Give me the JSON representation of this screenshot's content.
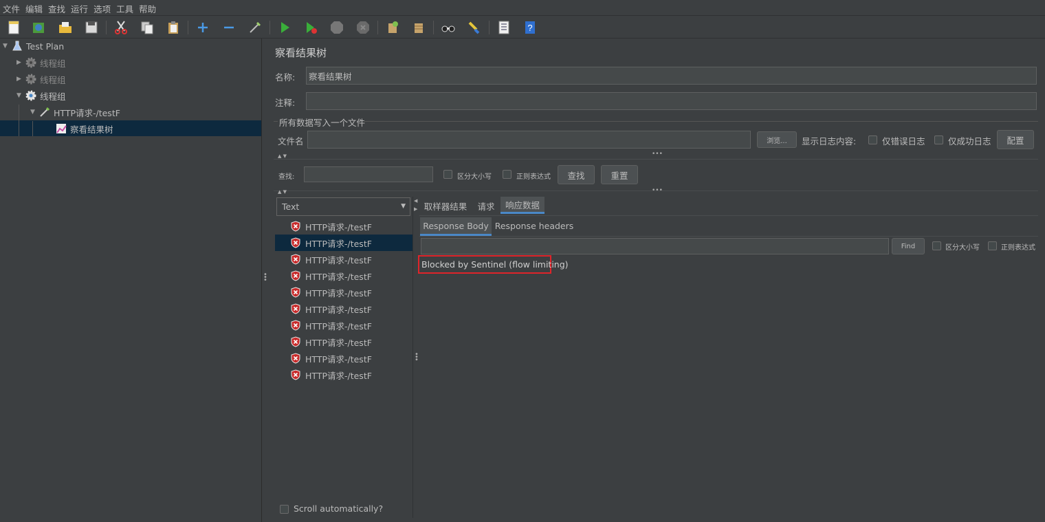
{
  "menu": [
    "文件",
    "编辑",
    "查找",
    "运行",
    "选项",
    "工具",
    "帮助"
  ],
  "toolbar_icons": [
    "new-icon",
    "templates-icon",
    "open-icon",
    "save-icon",
    "cut-icon",
    "copy-icon",
    "paste-icon",
    "expand-icon",
    "collapse-icon",
    "toggle-icon",
    "start-icon",
    "start-no-pause-icon",
    "stop-icon",
    "shutdown-icon",
    "clear-icon",
    "clear-all-icon",
    "search-icon",
    "reset-search-icon",
    "function-helper-icon",
    "help-icon"
  ],
  "tree": {
    "root": "Test Plan",
    "thread_group_1": "线程组",
    "thread_group_2": "线程组",
    "thread_group_3": "线程组",
    "http_sampler": "HTTP请求-/testF",
    "listener": "察看结果树"
  },
  "panel": {
    "title": "察看结果树",
    "name_label": "名称:",
    "name_value": "察看结果树",
    "comment_label": "注释:",
    "comment_value": "",
    "file_section": "所有数据写入一个文件",
    "filename_label": "文件名",
    "filename_value": "",
    "browse_button": "浏览...",
    "log_label": "显示日志内容:",
    "errors_only": "仅错误日志",
    "success_only": "仅成功日志",
    "configure_button": "配置"
  },
  "search": {
    "label": "查找:",
    "value": "",
    "case_sensitive": "区分大小写",
    "regex": "正则表达式",
    "find_button": "查找",
    "reset_button": "重置"
  },
  "results": {
    "renderer": "Text",
    "items": [
      "HTTP请求-/testF",
      "HTTP请求-/testF",
      "HTTP请求-/testF",
      "HTTP请求-/testF",
      "HTTP请求-/testF",
      "HTTP请求-/testF",
      "HTTP请求-/testF",
      "HTTP请求-/testF",
      "HTTP请求-/testF",
      "HTTP请求-/testF"
    ],
    "selected_index": 1,
    "scroll_auto": "Scroll automatically?"
  },
  "tabs": {
    "sampler_result": "取样器结果",
    "request": "请求",
    "response_data": "响应数据",
    "response_body": "Response Body",
    "response_headers": "Response headers"
  },
  "response": {
    "search_value": "",
    "find_button": "Find",
    "case_sensitive": "区分大小写",
    "regex": "正则表达式",
    "body": "Blocked by Sentinel (flow limiting)"
  },
  "colors": {
    "background": "#3c3f41",
    "selection": "#0d293e",
    "accent": "#4a88c7",
    "highlight_box": "#e0242a",
    "error_icon": "#c72a2a"
  }
}
